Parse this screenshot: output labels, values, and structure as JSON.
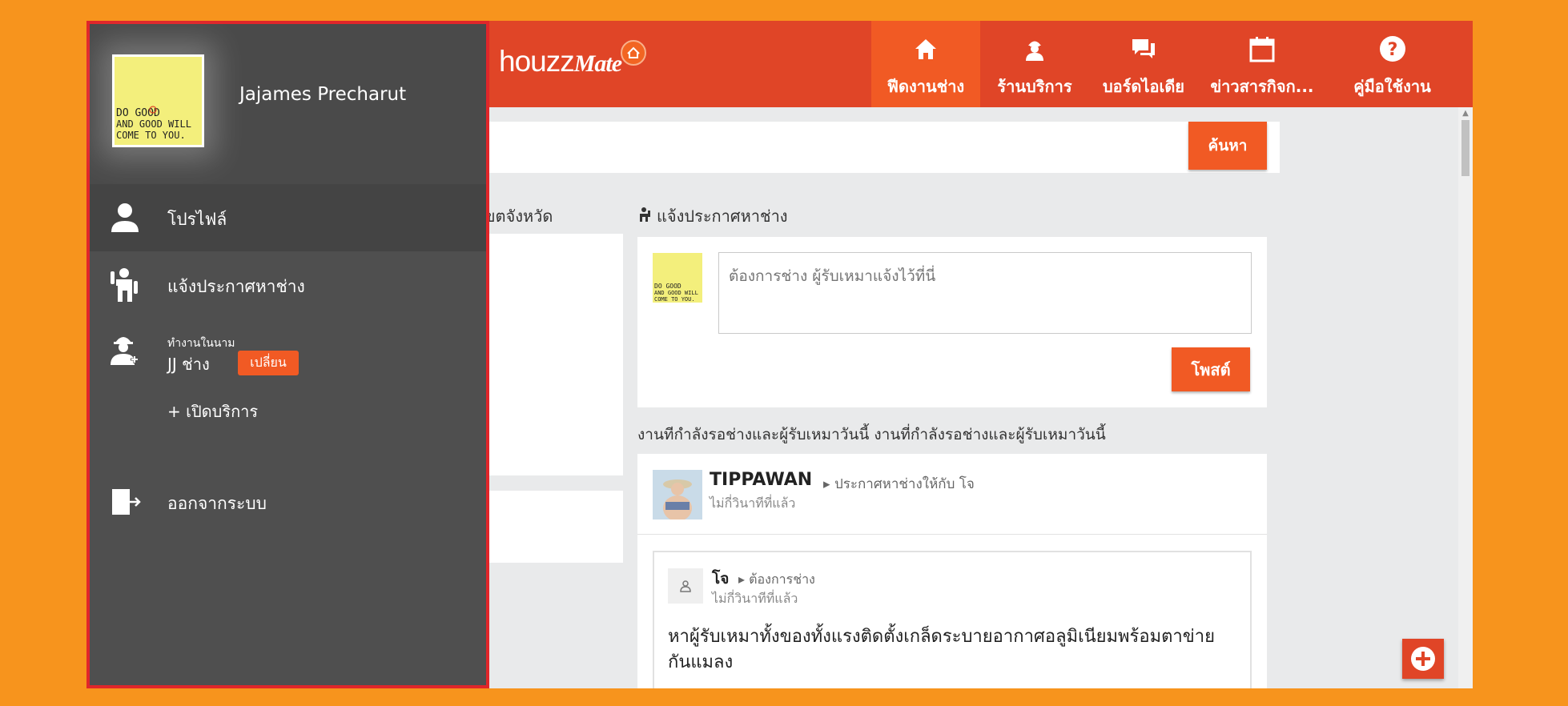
{
  "header": {
    "brand": "houzz",
    "brand_suffix": "Mate",
    "nav": [
      {
        "label": "ฟีดงานช่าง",
        "icon": "home-icon",
        "active": true
      },
      {
        "label": "ร้านบริการ",
        "icon": "worker-icon",
        "active": false
      },
      {
        "label": "บอร์ดไอเดีย",
        "icon": "chat-icon",
        "active": false
      },
      {
        "label": "ข่าวสารกิจก...",
        "icon": "calendar-icon",
        "active": false
      },
      {
        "label": "คู่มือใช้งาน",
        "icon": "help-icon",
        "active": false
      }
    ]
  },
  "search": {
    "placeholder": "",
    "button_label": "ค้นหา"
  },
  "left_column": {
    "label": "เขตจังหวัด"
  },
  "post": {
    "section_label": "แจ้งประกาศหาช่าง",
    "input_placeholder": "ต้องการช่าง ผู้รับเหมาแจ้งไว้ที่นี่",
    "button_label": "โพสต์"
  },
  "feed": {
    "heading": "งานทีกำลังรอช่างและผู้รับเหมาวันนี้ งานที่กำลังรอช่างและผู้รับเหมาวันนี้",
    "item": {
      "author": "TIPPAWAN",
      "action": "ประกาศหาช่างให้กับ โจ",
      "time": "ไม่กี่วินาทีที่แล้ว",
      "inner": {
        "name": "โจ",
        "action": "ต้องการช่าง",
        "time": "ไม่กี่วินาทีที่แล้ว",
        "body": "หาผู้รับเหมาทั้งของทั้งแรงติดตั้งเกล็ดระบายอากาศอลูมิเนียมพร้อมตาข่ายกันแมลง"
      }
    }
  },
  "avatar_text": [
    "DO GOOD",
    "AND GOOD WILL",
    "COME TO YOU."
  ],
  "drawer": {
    "username": "Jajames Precharut",
    "menu": [
      {
        "label": "โปรไฟล์",
        "icon": "profile-icon"
      },
      {
        "label": "แจ้งประกาศหาช่าง",
        "icon": "post-job-icon"
      }
    ],
    "role": {
      "caption": "ทำงานในนาม",
      "name": "JJ ช่าง",
      "switch_label": "เปลี่ยน"
    },
    "open_service": "+ เปิดบริการ",
    "logout": "ออกจากระบบ"
  },
  "colors": {
    "background": "#f7941d",
    "header": "#e04527",
    "accent": "#f15a24",
    "drawer": "#4f4f4f",
    "drawer_border": "#e0262a"
  }
}
